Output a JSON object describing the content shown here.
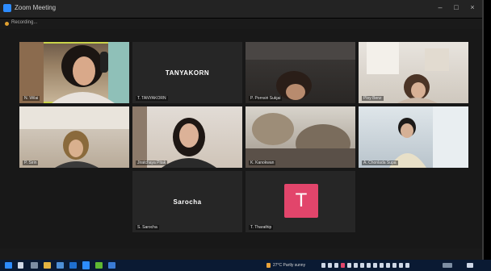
{
  "window": {
    "title": "Zoom Meeting"
  },
  "recording": {
    "label": "Recording..."
  },
  "participants": [
    {
      "name": "N. Wilai",
      "video": true
    },
    {
      "name": "TANYAKORN",
      "video": false,
      "name_label": "T. TANYAKORN"
    },
    {
      "name": "P. Pornsiri Sukjai",
      "video": true
    },
    {
      "name": "Ploy Benz",
      "video": true
    },
    {
      "name": "P. Sirin",
      "video": true
    },
    {
      "name": "Jiratchaya Pitak",
      "video": true
    },
    {
      "name": "K. Kanokwan",
      "video": true
    },
    {
      "name": "A. Chonlada Supa",
      "video": true
    },
    {
      "name": "Sarocha",
      "video": false,
      "name_label": "S. Sarocha"
    },
    {
      "name": "T. Tharathip",
      "video": false,
      "avatar_letter": "T",
      "avatar_color": "#e2456b"
    }
  ],
  "taskbar": {
    "weather": "27°C  Partly sunny"
  },
  "colors": {
    "active_speaker": "#c9d34a",
    "accent": "#2d8cff",
    "taskbar": "#0a1a33"
  }
}
